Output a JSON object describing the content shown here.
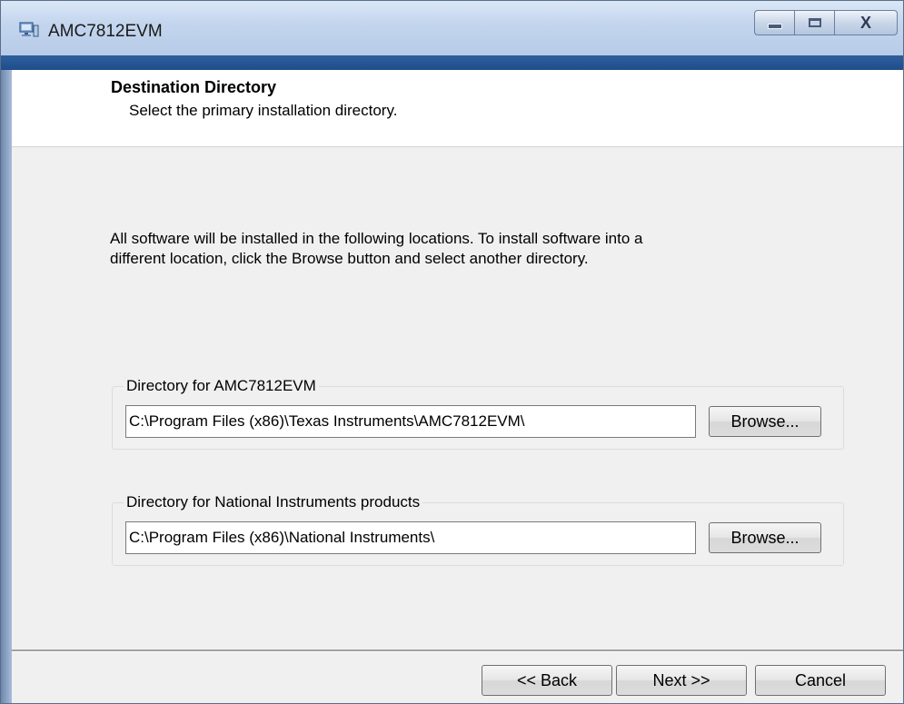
{
  "window": {
    "title": "AMC7812EVM",
    "app_icon": "computer-icon",
    "minimize_icon": "minimize-icon",
    "maximize_icon": "maximize-icon",
    "close_icon": "close-icon",
    "close_glyph": "X"
  },
  "header": {
    "title": "Destination Directory",
    "subtitle": "Select the primary installation directory."
  },
  "body": {
    "description_line1": "All software will be installed in the following locations. To install software into a",
    "description_line2": "different location, click the Browse button and select another directory.",
    "groups": [
      {
        "label": "Directory for AMC7812EVM",
        "path": "C:\\Program Files (x86)\\Texas Instruments\\AMC7812EVM\\",
        "browse_label": "Browse..."
      },
      {
        "label": "Directory for National Instruments products",
        "path": "C:\\Program Files (x86)\\National Instruments\\",
        "browse_label": "Browse..."
      }
    ]
  },
  "footer": {
    "back_label": "<< Back",
    "next_label": "Next >>",
    "cancel_label": "Cancel"
  },
  "colors": {
    "accent_band": "#1f4d8a",
    "dialog_bg": "#f0f0f0",
    "header_bg": "#ffffff"
  }
}
